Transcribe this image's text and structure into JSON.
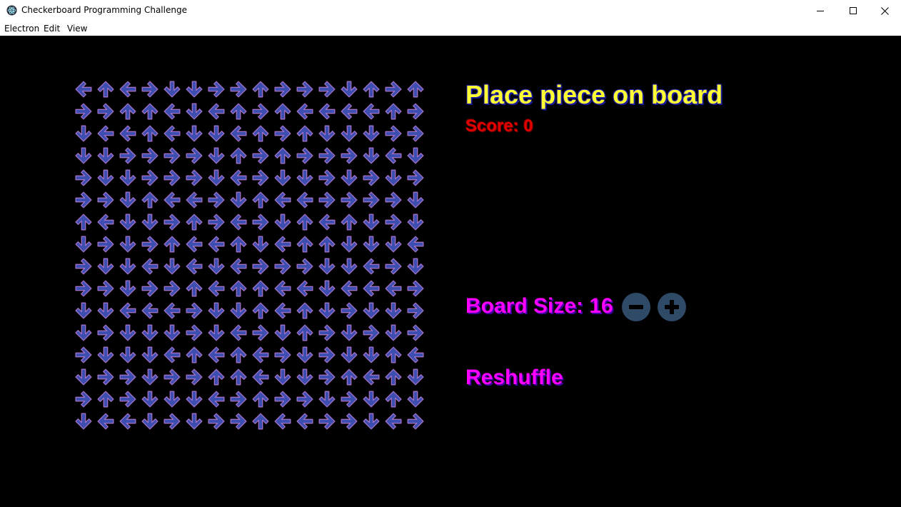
{
  "window": {
    "title": "Checkerboard Programming Challenge",
    "controls": [
      "minimize",
      "maximize",
      "close"
    ]
  },
  "menu": {
    "items": [
      "Electron",
      "Edit",
      "View"
    ]
  },
  "game": {
    "heading": "Place piece on board",
    "score_text": "Score: 0",
    "board_size_text": "Board Size: 16",
    "reshuffle_label": "Reshuffle",
    "board_size": 16,
    "board": [
      [
        "L",
        "U",
        "L",
        "R",
        "D",
        "D",
        "R",
        "R",
        "U",
        "R",
        "R",
        "R",
        "D",
        "U",
        "R",
        "U"
      ],
      [
        "R",
        "R",
        "U",
        "U",
        "L",
        "D",
        "L",
        "U",
        "R",
        "U",
        "L",
        "L",
        "L",
        "L",
        "U",
        "R"
      ],
      [
        "D",
        "L",
        "L",
        "U",
        "L",
        "D",
        "D",
        "L",
        "U",
        "R",
        "U",
        "D",
        "D",
        "D",
        "R",
        "R"
      ],
      [
        "D",
        "D",
        "R",
        "R",
        "R",
        "R",
        "D",
        "U",
        "R",
        "U",
        "R",
        "R",
        "R",
        "D",
        "L",
        "D"
      ],
      [
        "R",
        "D",
        "D",
        "R",
        "R",
        "R",
        "D",
        "L",
        "R",
        "D",
        "D",
        "R",
        "D",
        "R",
        "D",
        "R"
      ],
      [
        "R",
        "R",
        "D",
        "U",
        "L",
        "L",
        "R",
        "D",
        "U",
        "L",
        "L",
        "R",
        "R",
        "R",
        "R",
        "D"
      ],
      [
        "U",
        "L",
        "D",
        "D",
        "R",
        "U",
        "R",
        "L",
        "R",
        "D",
        "U",
        "L",
        "U",
        "D",
        "R",
        "D"
      ],
      [
        "D",
        "R",
        "D",
        "R",
        "U",
        "L",
        "L",
        "U",
        "D",
        "L",
        "U",
        "U",
        "D",
        "D",
        "D",
        "L"
      ],
      [
        "R",
        "D",
        "D",
        "L",
        "D",
        "L",
        "D",
        "L",
        "R",
        "R",
        "R",
        "D",
        "D",
        "L",
        "R",
        "D"
      ],
      [
        "R",
        "R",
        "D",
        "R",
        "R",
        "U",
        "L",
        "U",
        "U",
        "L",
        "L",
        "D",
        "L",
        "L",
        "L",
        "R"
      ],
      [
        "D",
        "D",
        "L",
        "L",
        "L",
        "R",
        "D",
        "D",
        "U",
        "L",
        "U",
        "D",
        "R",
        "D",
        "D",
        "R"
      ],
      [
        "D",
        "R",
        "D",
        "D",
        "D",
        "R",
        "D",
        "L",
        "R",
        "D",
        "U",
        "R",
        "D",
        "R",
        "D",
        "R"
      ],
      [
        "R",
        "D",
        "D",
        "D",
        "L",
        "U",
        "L",
        "U",
        "L",
        "R",
        "D",
        "R",
        "D",
        "D",
        "U",
        "L"
      ],
      [
        "D",
        "R",
        "R",
        "D",
        "R",
        "R",
        "U",
        "U",
        "L",
        "D",
        "D",
        "R",
        "U",
        "L",
        "U",
        "D"
      ],
      [
        "R",
        "U",
        "R",
        "D",
        "D",
        "D",
        "L",
        "R",
        "U",
        "R",
        "R",
        "D",
        "R",
        "D",
        "U",
        "D"
      ],
      [
        "D",
        "L",
        "L",
        "D",
        "R",
        "D",
        "R",
        "R",
        "U",
        "L",
        "L",
        "R",
        "R",
        "D",
        "L",
        "R"
      ]
    ],
    "colors": {
      "heading": "#ffff33",
      "score": "#e00000",
      "controls": "#ff00ff",
      "arrow_fill": "#3c4fb0",
      "arrow_edge": "#a070c8",
      "button_bg": "#2e4a66"
    }
  }
}
